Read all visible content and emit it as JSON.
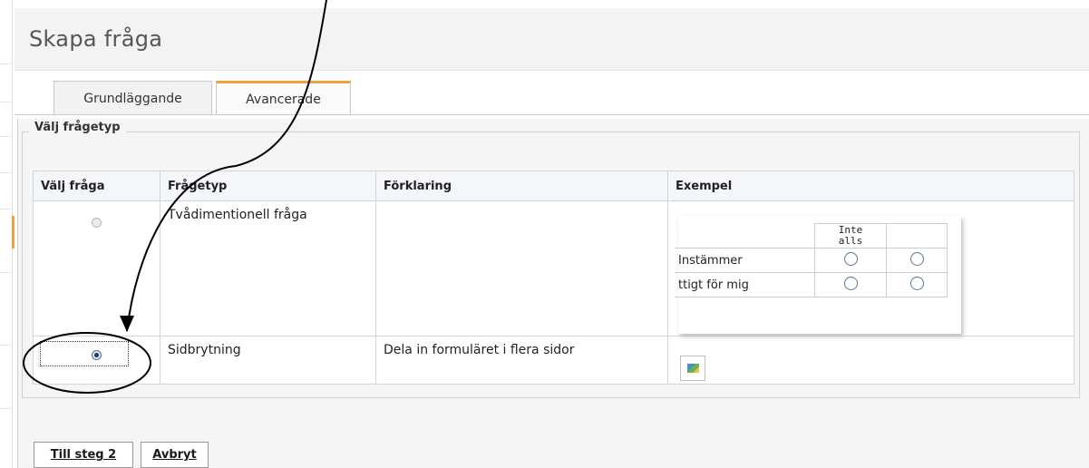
{
  "page": {
    "title": "Skapa fråga"
  },
  "tabs": [
    {
      "label": "Grundläggande",
      "active": false
    },
    {
      "label": "Avancerade",
      "active": true
    }
  ],
  "fieldset": {
    "legend": "Välj frågetyp"
  },
  "table": {
    "headers": [
      "Välj fråga",
      "Frågetyp",
      "Förklaring",
      "Exempel"
    ],
    "rows": [
      {
        "type": "Tvådimentionell fråga",
        "explanation": "",
        "selected": false
      },
      {
        "type": "Sidbrytning",
        "explanation": "Dela in formuläret i flera sidor",
        "selected": true
      }
    ]
  },
  "example": {
    "header": "Inte\nalls",
    "rows": [
      "Instämmer",
      "ttigt för mig"
    ]
  },
  "buttons": {
    "next": "Till steg 2",
    "cancel": "Avbryt"
  },
  "colors": {
    "tab_accent": "#f0a040",
    "header_bg": "#f3f3f3",
    "table_header_bg": "#f4f6fa"
  }
}
